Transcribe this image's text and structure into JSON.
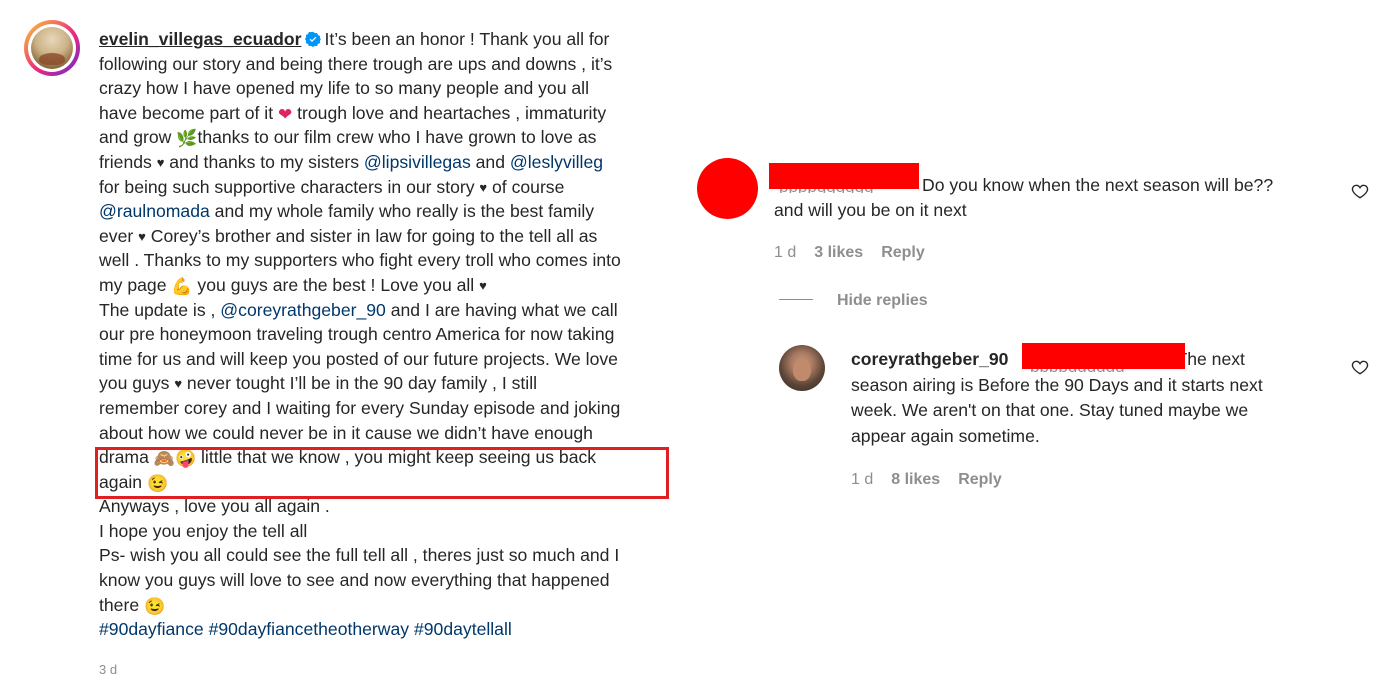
{
  "caption": {
    "username": "evelin_villegas_ecuador",
    "verified": true,
    "lines": [
      "It’s been an honor ! Thank you all for",
      "following our story and being there trough are ups and downs , it’s",
      "crazy how I have opened my life to so many people and you all",
      [
        "have become part of it ",
        " trough love and heartaches , immaturity"
      ],
      [
        "and grow ",
        "thanks to our film crew who I have grown to love as"
      ],
      [
        "friends ",
        " and thanks to my sisters ",
        "@lipsivillegas",
        " and ",
        "@leslyvilleg"
      ],
      [
        "for being such supportive characters in our story ",
        " of course"
      ],
      [
        "@raulnomada",
        " and my whole family who really is the best family"
      ],
      [
        "ever ",
        " Corey’s brother and sister in law for going to the tell all as"
      ],
      "well . Thanks to my supporters who fight every troll who comes into",
      [
        "my page ",
        " you guys are the best ! Love you all ",
        ""
      ],
      [
        "The update is , ",
        "@coreyrathgeber_90",
        " and I are having what we call"
      ],
      "our pre honeymoon traveling trough centro America for now taking",
      "time for us and will keep you posted of our future projects. We love",
      [
        "you guys ",
        " never tought I’ll be in the 90 day family , I still"
      ],
      "remember corey and I waiting for every Sunday episode and joking",
      "about how we could never be in it cause we didn’t have enough",
      [
        "drama ",
        " little that we know , you might keep seeing us back"
      ],
      [
        "again ",
        ""
      ],
      "Anyways , love you all again .",
      "I hope you enjoy the tell all",
      "Ps- wish you all could see the full tell all , theres just so much and I",
      "know you guys will love to see and now everything that happened",
      [
        "there ",
        ""
      ],
      [
        "#90dayfiance",
        " ",
        "#90dayfiancetheotherway",
        " ",
        "#90daytellall"
      ]
    ],
    "time": "3 d"
  },
  "icons": {
    "black_heart": "♥",
    "red_heart": "❤",
    "leaf": "🌿",
    "flexed_biceps": "💪",
    "see_no_evil": "🙈",
    "zany_face": "🤪",
    "wink_face": "😉"
  },
  "comments": [
    {
      "username_redacted": true,
      "text_line1": "Do you know when the next season will be??",
      "text_line2": "and will you be on it next",
      "time": "1 d",
      "likes": "3 likes",
      "reply": "Reply",
      "hide_replies": "Hide replies",
      "replies": [
        {
          "username": "coreyrathgeber_90",
          "text_line1": "The next",
          "text_line2": "season airing is Before the 90 Days and it starts next",
          "text_line3": "week. We aren't on that one. Stay tuned maybe we",
          "text_line4": "appear again sometime.",
          "time": "1 d",
          "likes": "8 likes",
          "reply": "Reply"
        }
      ]
    }
  ],
  "colors": {
    "text": "#262626",
    "muted": "#8e8e8e",
    "link": "#00376b",
    "redaction": "#ff0000",
    "highlight_box": "#e02020"
  }
}
